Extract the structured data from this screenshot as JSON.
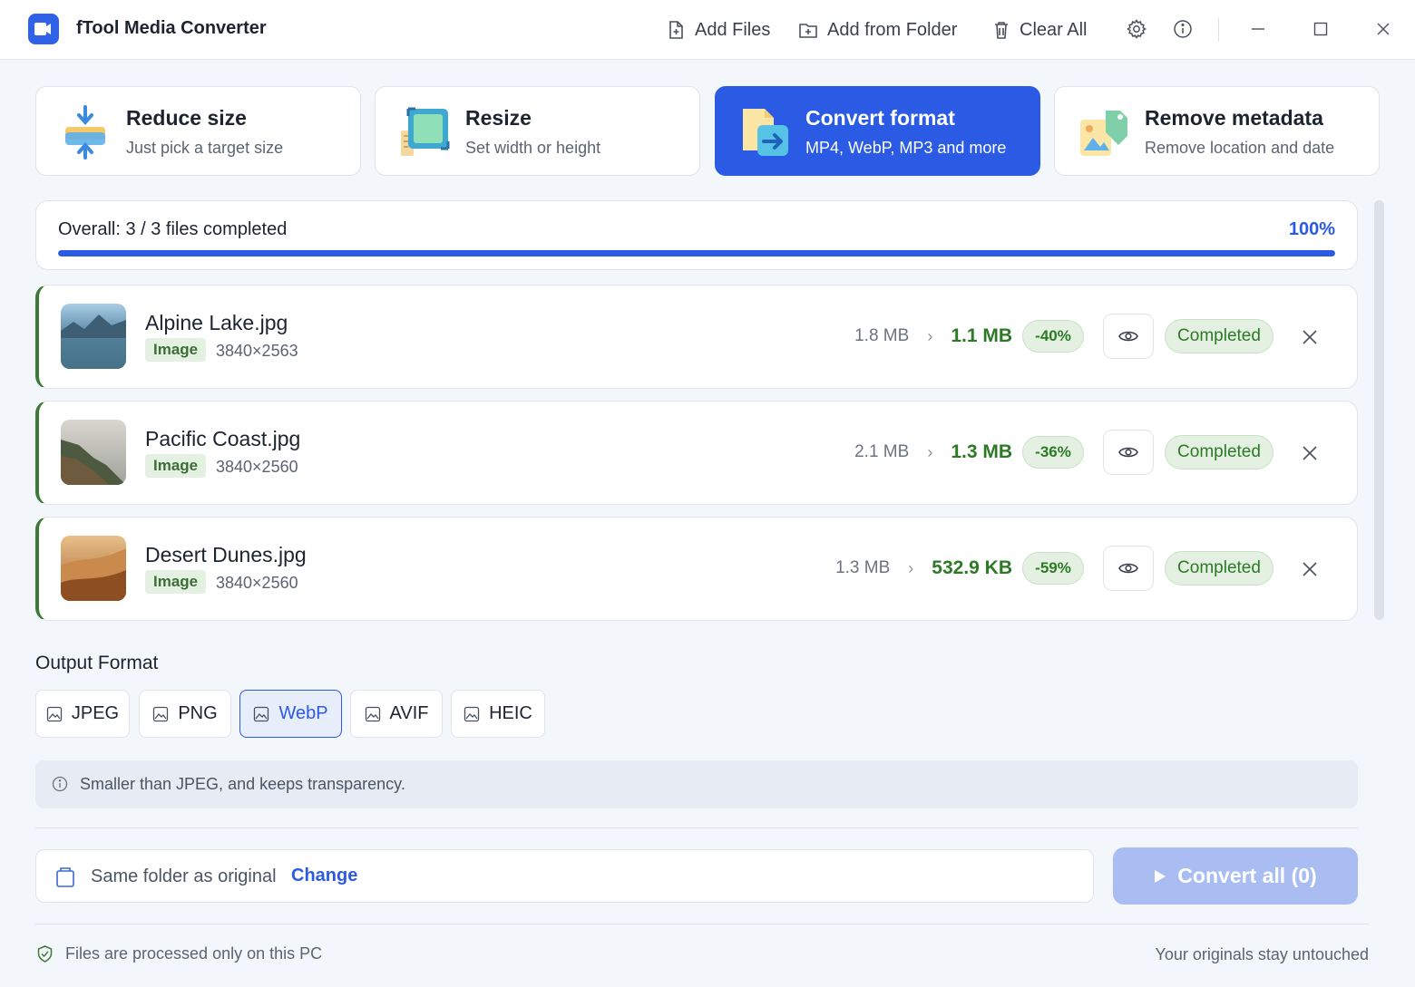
{
  "app": {
    "title": "fTool Media Converter"
  },
  "toolbar": {
    "add_files": "Add Files",
    "add_folder": "Add from Folder",
    "clear_all": "Clear All"
  },
  "modes": [
    {
      "title": "Reduce size",
      "subtitle": "Just pick a target size",
      "active": false
    },
    {
      "title": "Resize",
      "subtitle": "Set width or height",
      "active": false
    },
    {
      "title": "Convert format",
      "subtitle": "MP4, WebP, MP3 and more",
      "active": true
    },
    {
      "title": "Remove metadata",
      "subtitle": "Remove location and date",
      "active": false
    }
  ],
  "overall": {
    "label": "Overall: 3 / 3 files completed",
    "percent_text": "100%",
    "progress": 1.0
  },
  "files": [
    {
      "name": "Alpine Lake.jpg",
      "type": "Image",
      "dims": "3840×2563",
      "orig_size": "1.8 MB",
      "new_size": "1.1 MB",
      "delta": "-40%",
      "status": "Completed"
    },
    {
      "name": "Pacific Coast.jpg",
      "type": "Image",
      "dims": "3840×2560",
      "orig_size": "2.1 MB",
      "new_size": "1.3 MB",
      "delta": "-36%",
      "status": "Completed"
    },
    {
      "name": "Desert Dunes.jpg",
      "type": "Image",
      "dims": "3840×2560",
      "orig_size": "1.3 MB",
      "new_size": "532.9 KB",
      "delta": "-59%",
      "status": "Completed"
    }
  ],
  "output": {
    "title": "Output Format",
    "formats": [
      "JPEG",
      "PNG",
      "WebP",
      "AVIF",
      "HEIC"
    ],
    "selected": "WebP",
    "info": "Smaller than JPEG, and keeps transparency."
  },
  "destination": {
    "path": "Same folder as original",
    "change": "Change"
  },
  "convert_button": "Convert all (0)",
  "footer": {
    "left": "Files are processed only on this PC",
    "right": "Your originals stay untouched"
  },
  "colors": {
    "accent": "#2b5be4",
    "success": "#2c7a24",
    "success_bg": "#e4f1e2"
  }
}
